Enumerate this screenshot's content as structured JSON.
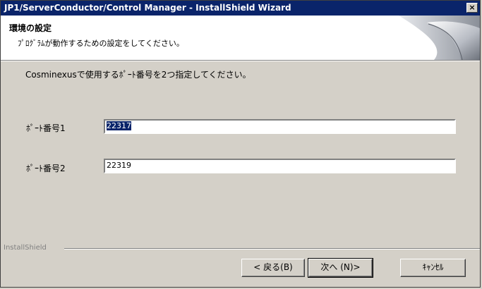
{
  "window": {
    "title": "JP1/ServerConductor/Control Manager - InstallShield Wizard",
    "close_glyph": "×"
  },
  "banner": {
    "title": "環境の設定",
    "subtitle": "ﾌﾟﾛｸﾞﾗﾑが動作するための設定をしてください。"
  },
  "content": {
    "instruction": "Cosminexusで使用するﾎﾟｰﾄ番号を2つ指定してください。",
    "port1": {
      "label": "ﾎﾟｰﾄ番号1",
      "value": "22317",
      "selected": true
    },
    "port2": {
      "label": "ﾎﾟｰﾄ番号2",
      "value": "22319"
    }
  },
  "footer": {
    "brand": "InstallShield",
    "back_label": "< 戻る(B)",
    "next_label": "次へ (N)>",
    "cancel_label": "ｷｬﾝｾﾙ"
  }
}
